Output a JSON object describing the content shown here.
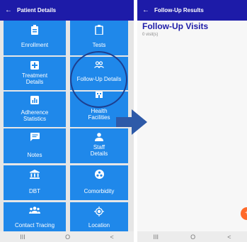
{
  "left_screen": {
    "title": "Patient Details",
    "back_icon": "arrow-left-icon",
    "tiles": [
      {
        "label": "Enrollment",
        "icon": "clipboard-id-icon"
      },
      {
        "label": "Tests",
        "icon": "clipboard-icon"
      },
      {
        "label": "Treatment\nDetails",
        "icon": "medical-plus-icon"
      },
      {
        "label": "Follow-Up Details",
        "icon": "people-icon"
      },
      {
        "label": "Adherence\nStatistics",
        "icon": "bar-chart-icon"
      },
      {
        "label": "Health\nFacilities",
        "icon": "building-icon"
      },
      {
        "label": "Notes",
        "icon": "notes-icon"
      },
      {
        "label": "Staff\nDetails",
        "icon": "person-icon"
      },
      {
        "label": "DBT",
        "icon": "bank-icon"
      },
      {
        "label": "Comorbidity",
        "icon": "biohazard-icon"
      },
      {
        "label": "Contact Tracing",
        "icon": "group-icon"
      },
      {
        "label": "Location",
        "icon": "location-target-icon"
      }
    ],
    "nav": {
      "recent": "III",
      "home": "O",
      "back": "<"
    }
  },
  "right_screen": {
    "title": "Follow-Up Results",
    "heading": "Follow-Up Visits",
    "count": "0 visit(s)",
    "fab_label": "+",
    "nav": {
      "recent": "III",
      "home": "O",
      "back": "<"
    }
  },
  "colors": {
    "appbar": "#1d1ba8",
    "tile": "#1f88ea",
    "fab": "#ff6a2a",
    "annotation": "#1d3f8f"
  }
}
